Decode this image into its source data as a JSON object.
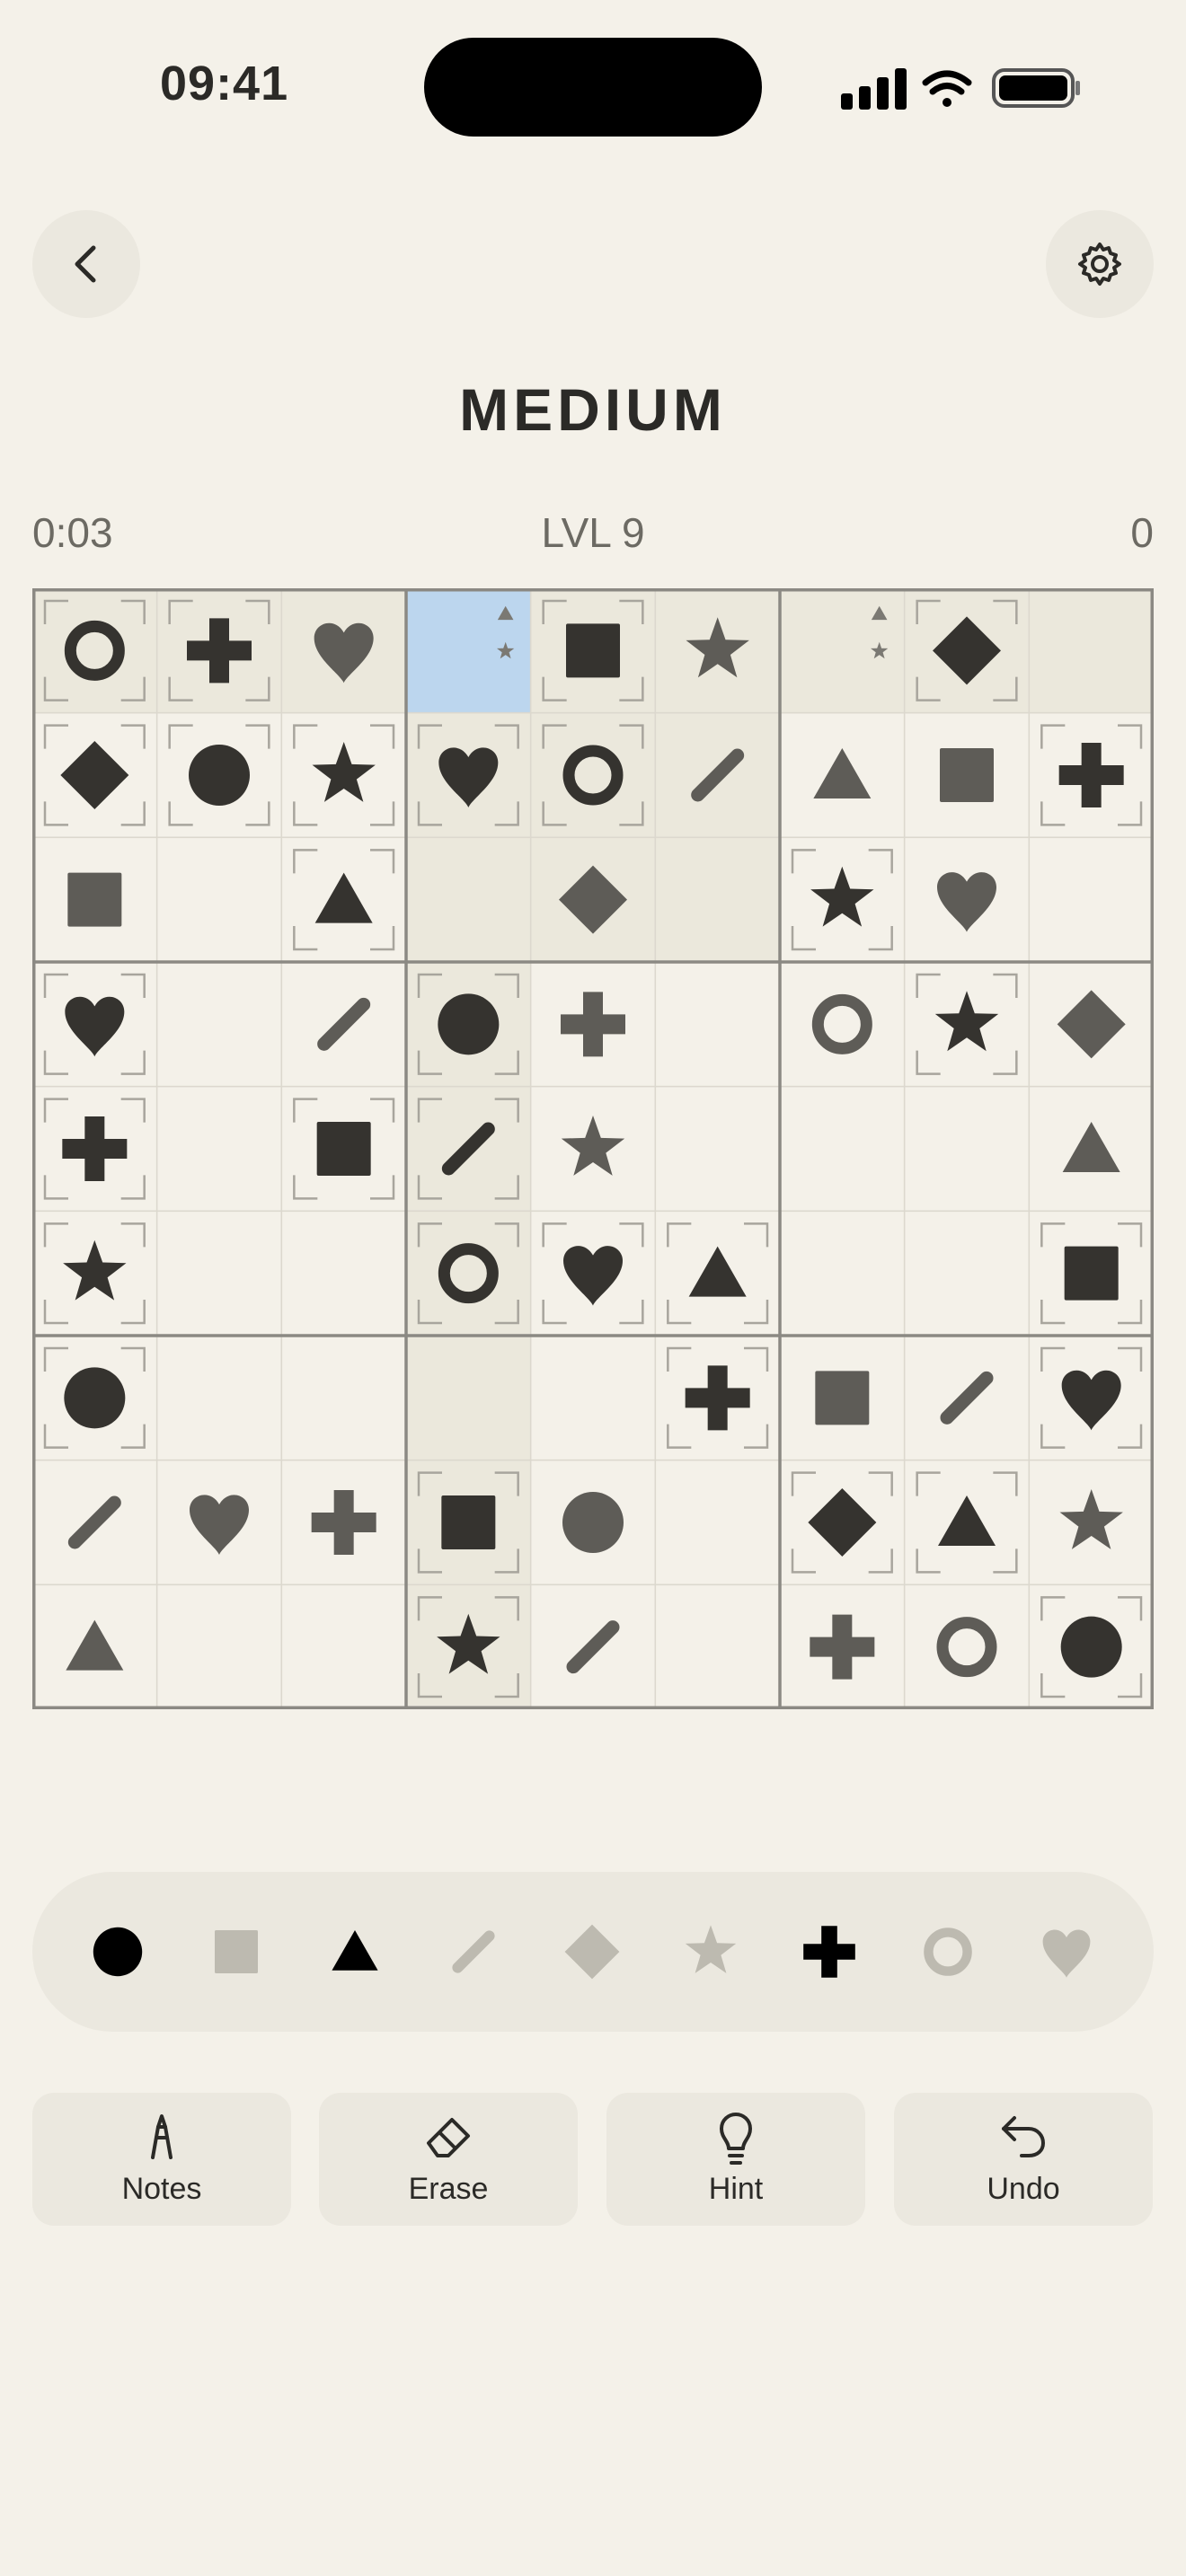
{
  "status_bar": {
    "time": "09:41",
    "icons": [
      "signal-icon",
      "wifi-icon",
      "battery-icon"
    ]
  },
  "header": {
    "back_icon": "chevron-left-icon",
    "settings_icon": "gear-icon"
  },
  "title": "MEDIUM",
  "stats": {
    "timer": "0:03",
    "level": "LVL 9",
    "score": "0"
  },
  "colors": {
    "background": "#f4f1e9",
    "selected_cell": "#bcd6ee",
    "highlight": "#ebe8dc",
    "given_symbol": "#35332f",
    "entered_symbol": "#5e5c57"
  },
  "selected_cell": {
    "row": 0,
    "col": 3
  },
  "board": [
    [
      "G:ring",
      "G:cross",
      "U:heart",
      "N:triangle,star",
      "G:square",
      "U:star",
      "N:triangle,star",
      "G:diamond",
      ""
    ],
    [
      "G:diamond",
      "G:circle",
      "G:star",
      "G:heart",
      "G:ring",
      "U:slash",
      "U:triangle",
      "U:square",
      "G:cross"
    ],
    [
      "U:square",
      "",
      "G:triangle",
      "",
      "U:diamond",
      "",
      "G:star",
      "U:heart",
      ""
    ],
    [
      "G:heart",
      "",
      "U:slash",
      "G:circle",
      "U:cross",
      "",
      "U:ring",
      "G:star",
      "U:diamond"
    ],
    [
      "G:cross",
      "",
      "G:square",
      "G:slash",
      "U:star",
      "",
      "",
      "",
      "U:triangle"
    ],
    [
      "G:star",
      "",
      "",
      "G:ring",
      "G:heart",
      "G:triangle",
      "",
      "",
      "G:square"
    ],
    [
      "G:circle",
      "",
      "",
      "",
      "",
      "G:cross",
      "U:square",
      "U:slash",
      "G:heart"
    ],
    [
      "U:slash",
      "U:heart",
      "U:cross",
      "G:square",
      "U:circle",
      "",
      "G:diamond",
      "G:triangle",
      "U:star"
    ],
    [
      "U:triangle",
      "",
      "",
      "G:star",
      "U:slash",
      "",
      "U:cross",
      "U:ring",
      "G:circle"
    ]
  ],
  "palette": [
    {
      "symbol": "circle",
      "state": "available"
    },
    {
      "symbol": "square",
      "state": "used"
    },
    {
      "symbol": "triangle",
      "state": "available"
    },
    {
      "symbol": "slash",
      "state": "used"
    },
    {
      "symbol": "diamond",
      "state": "used"
    },
    {
      "symbol": "star",
      "state": "used"
    },
    {
      "symbol": "cross",
      "state": "available"
    },
    {
      "symbol": "ring",
      "state": "used"
    },
    {
      "symbol": "heart",
      "state": "used"
    }
  ],
  "actions": [
    {
      "label": "Notes",
      "icon": "pencil-icon"
    },
    {
      "label": "Erase",
      "icon": "eraser-icon"
    },
    {
      "label": "Hint",
      "icon": "lightbulb-icon"
    },
    {
      "label": "Undo",
      "icon": "undo-icon"
    }
  ]
}
